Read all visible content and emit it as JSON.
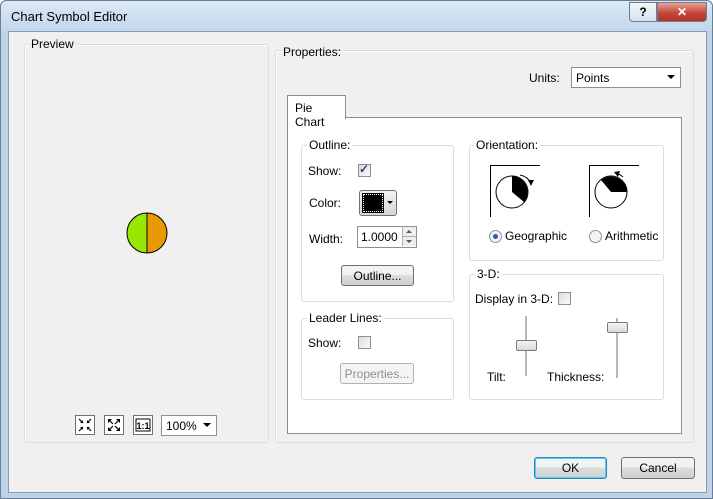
{
  "window": {
    "title": "Chart Symbol Editor",
    "help_glyph": "?",
    "close_glyph": "✕"
  },
  "preview": {
    "label": "Preview",
    "pie_colors": {
      "left": "#99e600",
      "right": "#e69900"
    },
    "zoom_value": "100%"
  },
  "properties": {
    "label": "Properties:",
    "units_label": "Units:",
    "units_value": "Points",
    "tab_label": "Pie Chart",
    "outline": {
      "group_label": "Outline:",
      "show_label": "Show:",
      "show_checked": true,
      "color_label": "Color:",
      "width_label": "Width:",
      "width_value": "1.0000",
      "button_label": "Outline..."
    },
    "leader": {
      "group_label": "Leader Lines:",
      "show_label": "Show:",
      "show_checked": false,
      "button_label": "Properties..."
    },
    "orientation": {
      "group_label": "Orientation:",
      "geographic_label": "Geographic",
      "arithmetic_label": "Arithmetic",
      "selected": "Geographic"
    },
    "three_d": {
      "group_label": "3-D:",
      "display_label": "Display in 3-D:",
      "display_checked": false,
      "tilt_label": "Tilt:",
      "thickness_label": "Thickness:"
    }
  },
  "footer": {
    "ok_label": "OK",
    "cancel_label": "Cancel"
  }
}
